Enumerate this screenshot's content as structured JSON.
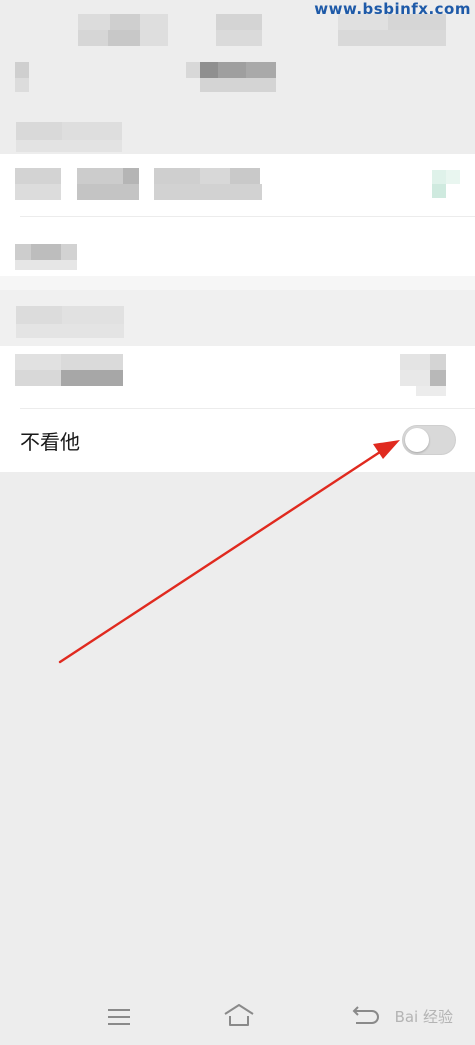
{
  "watermark": {
    "top_text": "www.bsbinfx.com",
    "bottom_text": "Bai 经验"
  },
  "settings": {
    "hide_his_moments": {
      "label": "不看他",
      "enabled": false
    }
  },
  "annotation": {
    "arrow_color": "#e02a1f"
  },
  "navbar": {
    "icons": [
      "menu-icon",
      "home-icon",
      "back-icon"
    ]
  }
}
